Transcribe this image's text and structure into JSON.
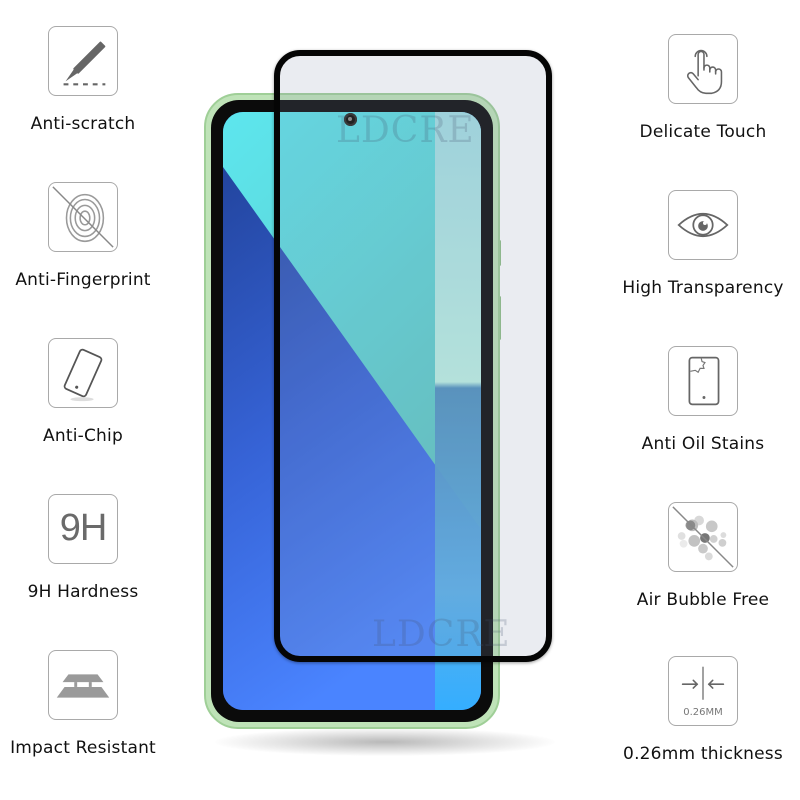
{
  "watermark": "LDCRE",
  "features_left": [
    {
      "icon": "scalpel-scratch-icon",
      "label": "Anti-scratch"
    },
    {
      "icon": "no-fingerprint-icon",
      "label": "Anti-Fingerprint"
    },
    {
      "icon": "tilted-phone-icon",
      "label": "Anti-Chip"
    },
    {
      "icon": "9h-text-icon",
      "label": "9H Hardness",
      "icon_text": "9H"
    },
    {
      "icon": "impact-layers-icon",
      "label": "Impact Resistant"
    }
  ],
  "features_right": [
    {
      "icon": "touch-hand-icon",
      "label": "Delicate Touch"
    },
    {
      "icon": "eye-icon",
      "label": "High Transparency"
    },
    {
      "icon": "phone-stain-icon",
      "label": "Anti Oil Stains"
    },
    {
      "icon": "no-bubbles-icon",
      "label": "Air Bubble Free"
    },
    {
      "icon": "thickness-arrows-icon",
      "label": "0.26mm thickness",
      "icon_text": "0.26MM"
    }
  ],
  "colors": {
    "icon_gray": "#6b6b6b",
    "icon_border": "#a9a9a9",
    "phone_frame": "#bfe3b8",
    "glass_border": "#050505"
  }
}
